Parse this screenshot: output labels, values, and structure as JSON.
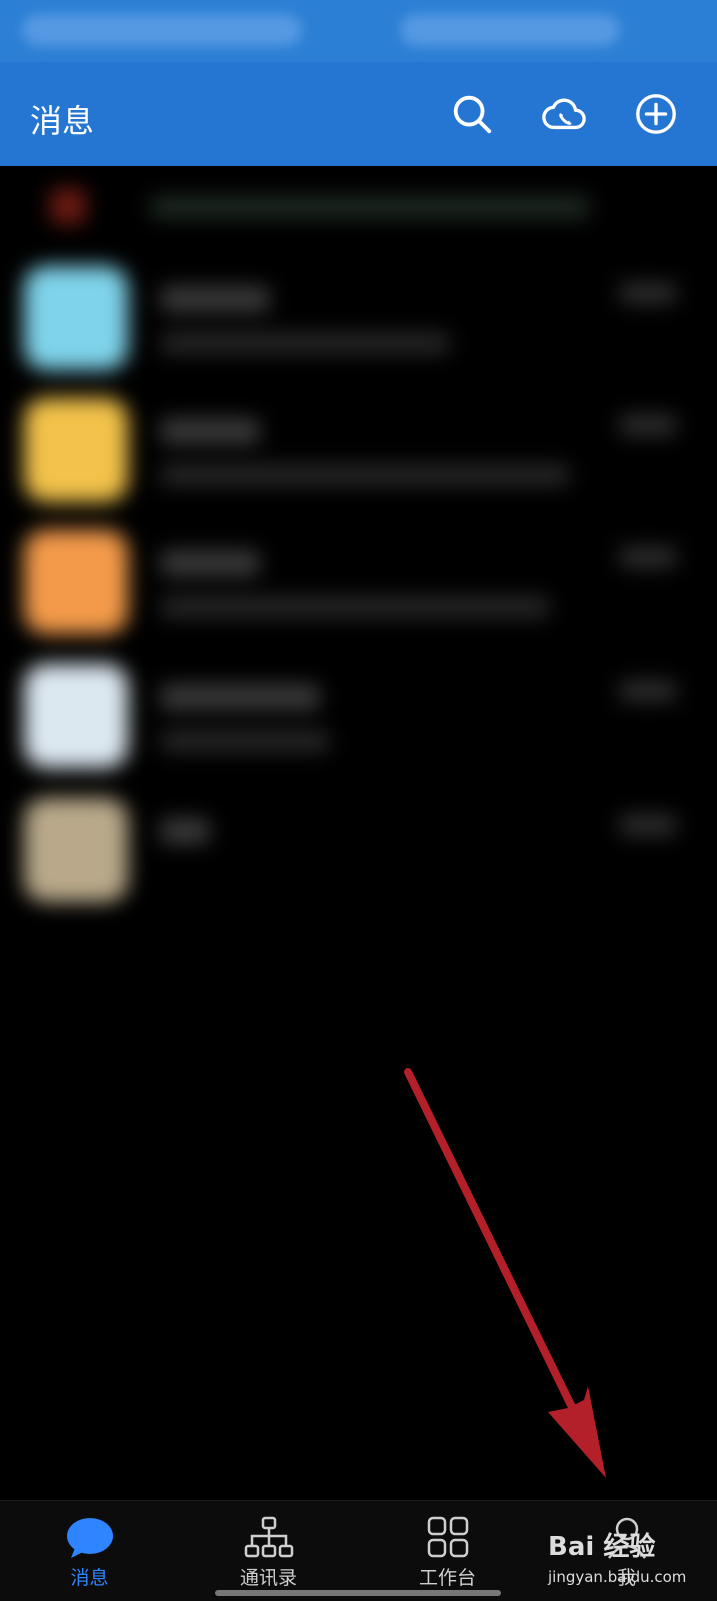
{
  "header": {
    "title": "消息",
    "icons": [
      "search-icon",
      "cloud-phone-icon",
      "plus-circle-icon"
    ],
    "bg_color": "#2576d3"
  },
  "tabs": [
    {
      "label": "消息",
      "icon": "chat-bubble-icon",
      "active": true
    },
    {
      "label": "通讯录",
      "icon": "org-chart-icon",
      "active": false
    },
    {
      "label": "工作台",
      "icon": "grid-icon",
      "active": false
    },
    {
      "label": "我",
      "icon": "person-icon",
      "active": false
    }
  ],
  "colors": {
    "accent": "#2f84ff",
    "arrow": "#b3202a"
  },
  "watermark": {
    "top": "Bai 经验",
    "bottom": "jingyan.baidu.com"
  }
}
